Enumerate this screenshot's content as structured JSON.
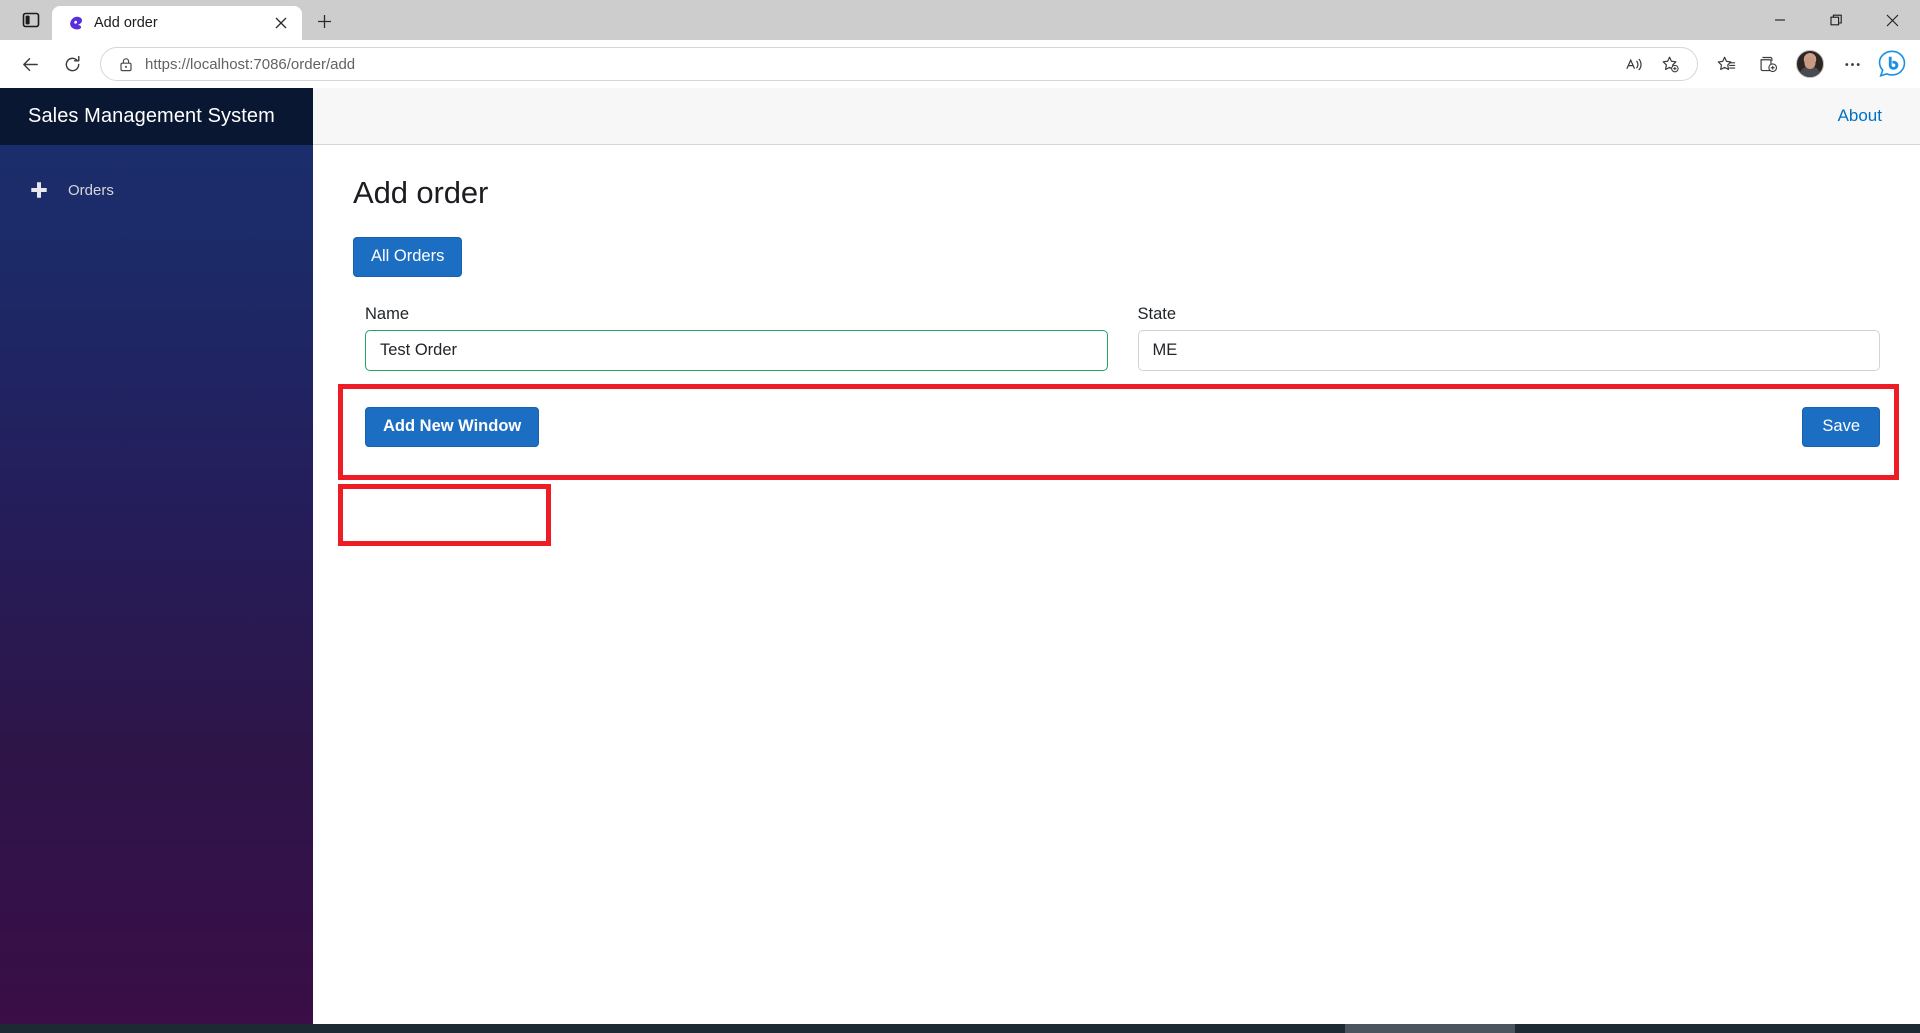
{
  "browser": {
    "tab": {
      "title": "Add order",
      "favicon_icon": "blazor-logo-icon",
      "close_icon": "close-icon"
    },
    "tab_search_icon": "tab-search-icon",
    "new_tab_icon": "new-tab-icon",
    "window_controls": {
      "minimize_icon": "minimize-icon",
      "restore_icon": "restore-icon",
      "close_icon": "window-close-icon"
    },
    "toolbar": {
      "back_icon": "back-arrow-icon",
      "refresh_icon": "refresh-icon",
      "lock_icon": "lock-icon",
      "url": "https://localhost:7086/order/add",
      "url_scheme": "https://",
      "url_host": "localhost",
      "url_path": ":7086/order/add",
      "read_aloud_icon": "read-aloud-icon",
      "add_favorite_icon": "add-favorite-star-icon",
      "favorites_icon": "favorites-list-icon",
      "collections_icon": "collections-icon",
      "avatar_icon": "profile-avatar",
      "settings_icon": "more-options-icon",
      "copilot_icon": "bing-copilot-icon"
    }
  },
  "sidebar": {
    "brand": "Sales Management System",
    "items": [
      {
        "label": "Orders",
        "icon": "plus-icon"
      }
    ]
  },
  "topbar": {
    "about_link": "About"
  },
  "main": {
    "page_title": "Add order",
    "all_orders_button": "All Orders",
    "form": {
      "fields": [
        {
          "label": "Name",
          "value": "Test Order",
          "placeholder": "",
          "state": "valid"
        },
        {
          "label": "State",
          "value": "ME",
          "placeholder": "",
          "state": "default"
        }
      ]
    },
    "add_new_window_button": "Add New Window",
    "save_button": "Save"
  },
  "colors": {
    "accent_blue": "#1b6ec2",
    "link_blue": "#0071c1",
    "highlight_red": "#ee1c25",
    "valid_green": "#26a269",
    "sidebar_brand_bg": "#0a1732"
  }
}
